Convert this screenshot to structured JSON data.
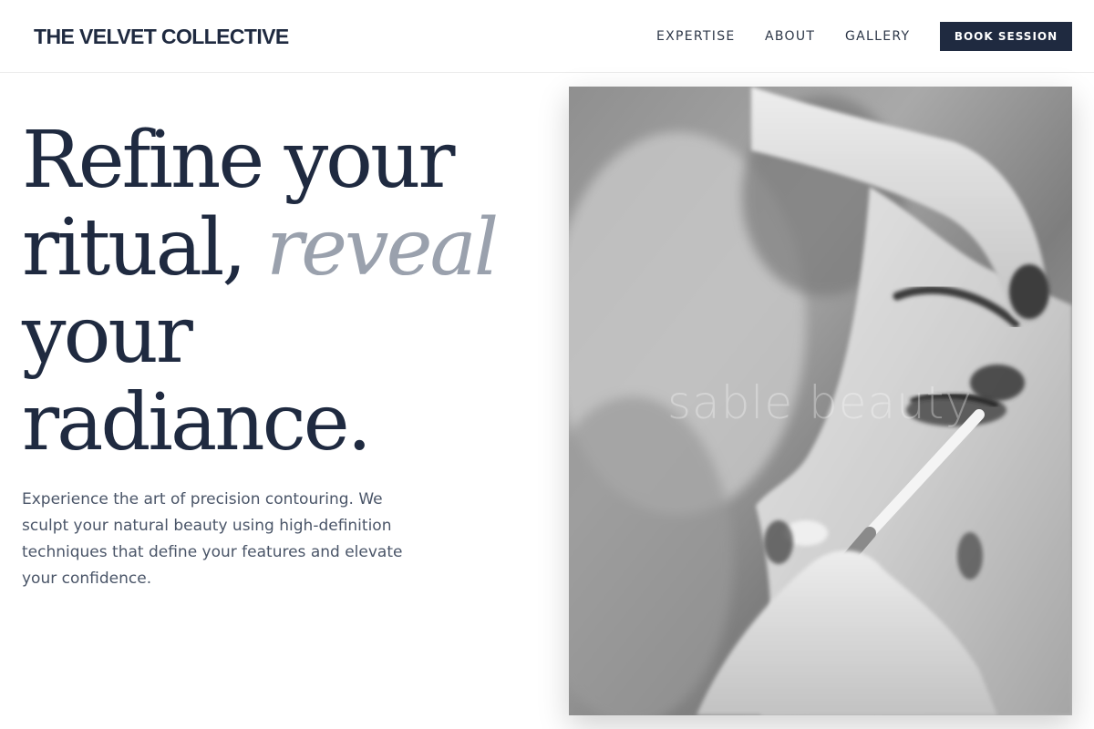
{
  "header": {
    "brand": "THE VELVET COLLECTIVE",
    "nav": {
      "expertise": "EXPERTISE",
      "about": "ABOUT",
      "gallery": "GALLERY"
    },
    "cta_label": "BOOK SESSION"
  },
  "hero": {
    "headline": {
      "line1": "Refine your",
      "line2_start": "ritual, ",
      "line2_accent": "reveal",
      "line3": "your",
      "line4": "radiance."
    },
    "intro": "Experience the art of precision contouring. We sculpt your natural beauty using high-definition techniques that define your features and elevate your confidence.",
    "photo": {
      "watermark": "sable beauty"
    }
  },
  "colors": {
    "primary": "#1f2a40",
    "accent_text": "#9aa1ad",
    "body_text": "#4a5568",
    "background": "#ffffff"
  }
}
